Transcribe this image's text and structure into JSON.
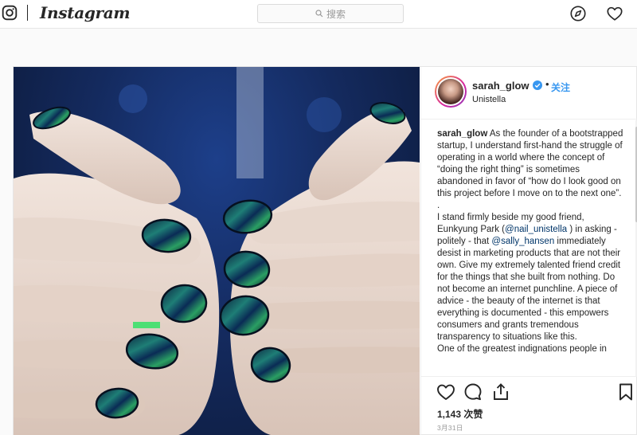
{
  "nav": {
    "wordmark": "Instagram",
    "search_placeholder": "搜索",
    "icons": [
      "instagram-glyph-icon",
      "search-icon",
      "explore-compass-icon",
      "heart-icon"
    ]
  },
  "post": {
    "username": "sarah_glow",
    "verified": true,
    "separator": "•",
    "follow_label": "关注",
    "location": "Unistella",
    "caption": {
      "author": "sarah_glow",
      "p1": " As the founder of a bootstrapped startup, I understand first-hand the struggle of operating in a world where the concept of “doing the right thing” is sometimes abandoned in favor of “how do I look good on this project before I move on to the next one”.",
      "p2": ".",
      "p3_a": "I stand firmly beside my good friend, Eunkyung Park (",
      "mention1": "@nail_unistella",
      "p3_b": " ) in asking - politely - that ",
      "mention2": "@sally_hansen",
      "p3_c": " immediately desist in marketing products that are not their own. Give my extremely talented friend credit for the things that she built from nothing. Do not become an internet punchline. A piece of advice - the beauty of the internet is that everything is documented - this empowers consumers and grants tremendous transparency to situations like this.",
      "p4": "One of the greatest indignations people in"
    },
    "likes": "1,143 次赞",
    "date": "3月31日",
    "action_icons": [
      "heart-icon",
      "comment-icon",
      "share-icon",
      "bookmark-icon"
    ],
    "colors": {
      "link": "#3897f0",
      "mention": "#003569",
      "border": "#efefef"
    }
  }
}
